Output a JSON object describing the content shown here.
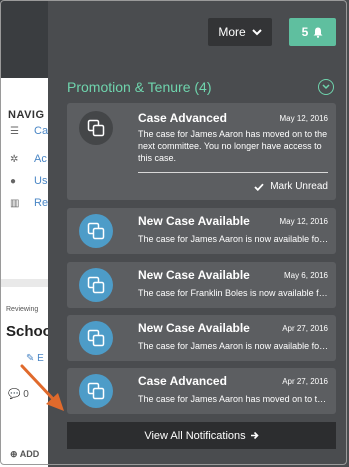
{
  "background": {
    "nav_title": "NAVIG",
    "nav_items": [
      {
        "icon": "list-icon",
        "label": "Ca"
      },
      {
        "icon": "gear-icon",
        "label": "Ac"
      },
      {
        "icon": "users-icon",
        "label": "Us"
      },
      {
        "icon": "bar-chart-icon",
        "label": "Re"
      }
    ],
    "reviewing_label": "Reviewing",
    "page_heading": "Schoo",
    "edit_label": "E",
    "comment_count": "0",
    "add_label": "ADD"
  },
  "header": {
    "more_label": "More",
    "notification_count": "5"
  },
  "section": {
    "title": "Promotion & Tenure (4)"
  },
  "notifications": [
    {
      "title": "Case Advanced",
      "date": "May 12, 2016",
      "message": "The case for James Aaron has moved on to the next committee. You no longer have access to this case.",
      "action": "Mark Unread",
      "expanded": true
    },
    {
      "title": "New Case Available",
      "date": "May 12, 2016",
      "message": "The case for James Aaron is now available for review."
    },
    {
      "title": "New Case Available",
      "date": "May 6, 2016",
      "message": "The case for Franklin Boles is now available for review."
    },
    {
      "title": "New Case Available",
      "date": "Apr 27, 2016",
      "message": "The case for James Aaron is now available for review."
    },
    {
      "title": "Case Advanced",
      "date": "Apr 27, 2016",
      "message": "The case for James Aaron has moved on to the next committee."
    }
  ],
  "footer": {
    "view_all_label": "View All Notifications"
  },
  "colors": {
    "panel_bg": "#4a4c4f",
    "card_bg": "#5c5e61",
    "accent_green": "#5fbf9f",
    "section_title": "#6fd4ad",
    "icon_blue": "#4d9cc8",
    "arrow_orange": "#e06a2c"
  }
}
